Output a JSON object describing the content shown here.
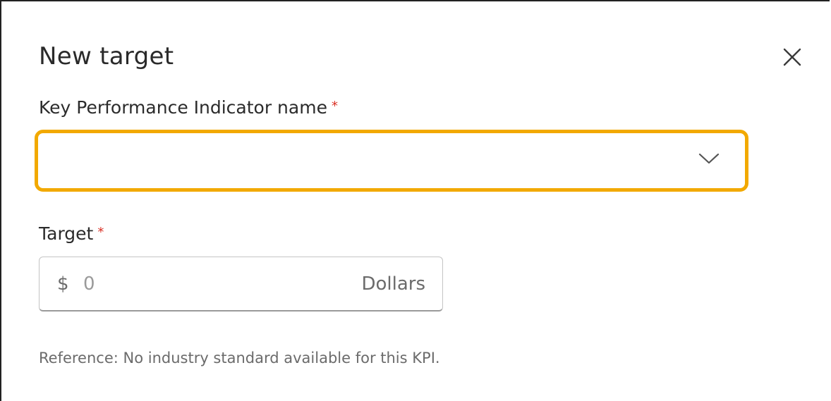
{
  "dialog": {
    "title": "New target",
    "close_icon": "close-icon"
  },
  "kpi_field": {
    "label": "Key Performance Indicator name",
    "required_marker": "*",
    "selected_value": "",
    "icon": "chevron-down-icon",
    "accent_color": "#f2a900"
  },
  "target_field": {
    "label": "Target",
    "required_marker": "*",
    "prefix": "$",
    "placeholder": "0",
    "value": "",
    "suffix": "Dollars"
  },
  "reference": {
    "text": "Reference: No industry standard available for this KPI."
  },
  "colors": {
    "required": "#d93025",
    "focus_border": "#f2a900"
  }
}
